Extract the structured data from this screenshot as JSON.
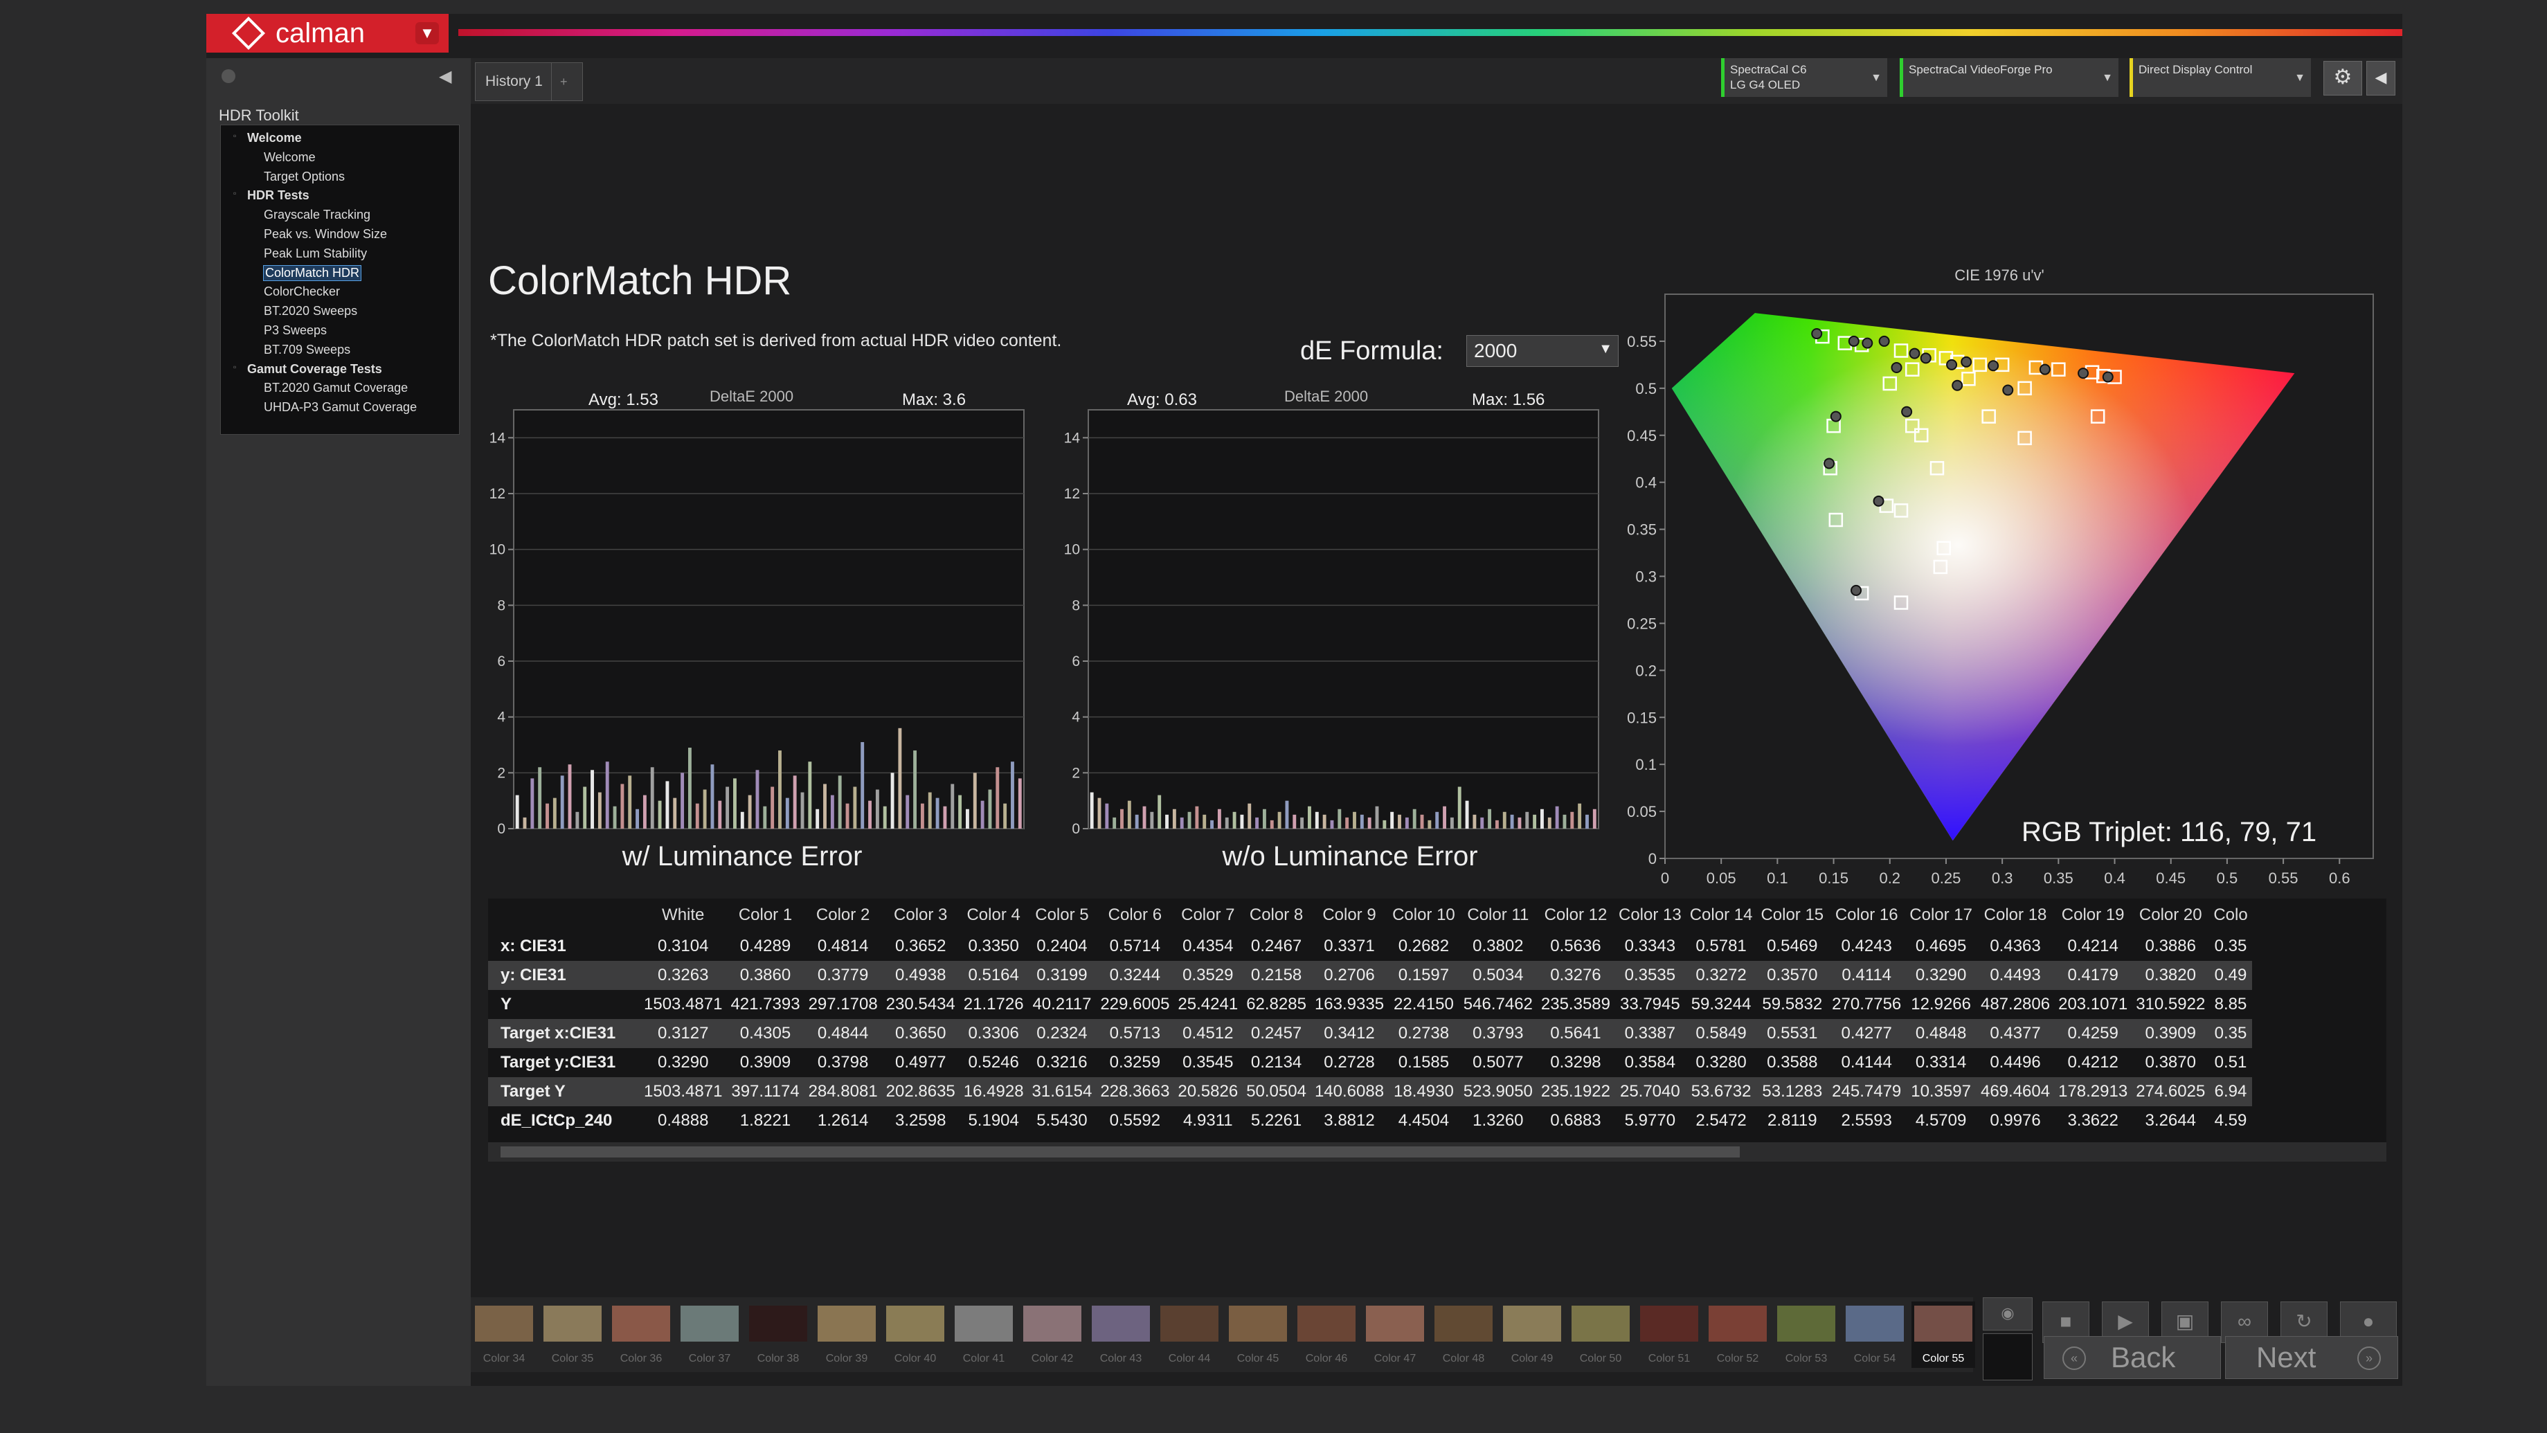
{
  "app": {
    "logo_text": "calman"
  },
  "sidebar": {
    "title": "HDR Toolkit",
    "items": [
      {
        "label": "Welcome",
        "level": 0
      },
      {
        "label": "Welcome",
        "level": 1
      },
      {
        "label": "Target Options",
        "level": 1
      },
      {
        "label": "HDR Tests",
        "level": 0
      },
      {
        "label": "Grayscale Tracking",
        "level": 1
      },
      {
        "label": "Peak vs. Window Size",
        "level": 1
      },
      {
        "label": "Peak Lum Stability",
        "level": 1
      },
      {
        "label": "ColorMatch HDR",
        "level": 1,
        "selected": true
      },
      {
        "label": "ColorChecker",
        "level": 1
      },
      {
        "label": "BT.2020 Sweeps",
        "level": 1
      },
      {
        "label": "P3 Sweeps",
        "level": 1
      },
      {
        "label": "BT.709 Sweeps",
        "level": 1
      },
      {
        "label": "Gamut Coverage Tests",
        "level": 0
      },
      {
        "label": "BT.2020 Gamut Coverage",
        "level": 1
      },
      {
        "label": "UHDA-P3 Gamut Coverage",
        "level": 1
      }
    ]
  },
  "tabs": {
    "history": "History 1"
  },
  "devices": [
    {
      "line1": "SpectraCal C6",
      "line2": "LG G4 OLED"
    },
    {
      "line1": "SpectraCal VideoForge Pro",
      "line2": ""
    },
    {
      "line1": "Direct Display Control",
      "line2": ""
    }
  ],
  "page": {
    "title": "ColorMatch HDR",
    "note": "*The ColorMatch HDR patch set is derived from actual HDR video content.",
    "de_label": "dE Formula:",
    "de_value": "2000"
  },
  "charts": {
    "left": {
      "avg": "Avg: 1.53",
      "formula": "DeltaE 2000",
      "max": "Max: 3.6",
      "caption": "w/ Luminance Error"
    },
    "right": {
      "avg": "Avg: 0.63",
      "formula": "DeltaE 2000",
      "max": "Max: 1.56",
      "caption": "w/o Luminance Error"
    },
    "cie": {
      "title": "CIE 1976 u'v'",
      "rgb_triplet": "RGB Triplet: 116, 79, 71"
    }
  },
  "chart_data": [
    {
      "type": "bar",
      "title": "DeltaE 2000",
      "xlabel": "w/ Luminance Error",
      "ylim": [
        0,
        15
      ],
      "yticks": [
        0,
        2,
        4,
        6,
        8,
        10,
        12,
        14
      ],
      "values": [
        1.2,
        0.4,
        1.8,
        2.2,
        0.9,
        1.1,
        1.9,
        2.3,
        0.6,
        1.5,
        2.1,
        1.3,
        2.4,
        0.8,
        1.6,
        1.9,
        0.7,
        1.2,
        2.2,
        1.0,
        1.7,
        1.1,
        2.0,
        2.9,
        0.9,
        1.4,
        2.3,
        1.0,
        1.5,
        1.8,
        0.6,
        1.2,
        2.1,
        0.8,
        1.5,
        2.8,
        1.1,
        1.9,
        1.3,
        2.4,
        0.7,
        1.6,
        1.2,
        1.9,
        0.9,
        1.5,
        3.1,
        1.0,
        1.4,
        0.8,
        2.0,
        3.6,
        1.2,
        2.8,
        0.9,
        1.3,
        1.1,
        0.8,
        1.6,
        1.2,
        0.7,
        2.0,
        1.0,
        1.4,
        2.2,
        0.9,
        2.4,
        1.8
      ]
    },
    {
      "type": "bar",
      "title": "DeltaE 2000",
      "xlabel": "w/o Luminance Error",
      "ylim": [
        0,
        15
      ],
      "yticks": [
        0,
        2,
        4,
        6,
        8,
        10,
        12,
        14
      ],
      "values": [
        1.3,
        1.1,
        0.9,
        0.4,
        0.7,
        1.0,
        0.5,
        0.8,
        0.6,
        1.2,
        0.5,
        0.7,
        0.4,
        0.6,
        0.8,
        0.5,
        0.3,
        0.7,
        0.4,
        0.6,
        0.5,
        0.9,
        0.4,
        0.7,
        0.3,
        0.6,
        1.0,
        0.5,
        0.4,
        0.8,
        0.6,
        0.5,
        0.3,
        0.7,
        0.4,
        0.6,
        0.5,
        0.4,
        0.8,
        0.3,
        0.6,
        0.5,
        0.4,
        0.7,
        0.5,
        0.3,
        0.6,
        0.8,
        0.4,
        1.5,
        1.0,
        0.5,
        0.4,
        0.7,
        0.3,
        0.6,
        0.5,
        0.4,
        0.6,
        0.5,
        0.7,
        0.4,
        0.8,
        0.5,
        0.6,
        0.9,
        0.5,
        0.7
      ]
    },
    {
      "type": "scatter",
      "title": "CIE 1976 u'v'",
      "xlim": [
        0,
        0.63
      ],
      "ylim": [
        0,
        0.6
      ],
      "xticks": [
        0,
        0.05,
        0.1,
        0.15,
        0.2,
        0.25,
        0.3,
        0.35,
        0.4,
        0.45,
        0.5,
        0.55,
        0.6
      ],
      "yticks": [
        0,
        0.05,
        0.1,
        0.15,
        0.2,
        0.25,
        0.3,
        0.35,
        0.4,
        0.45,
        0.5,
        0.55
      ],
      "gamut": [
        [
          0.256,
          0.019
        ],
        [
          0.56,
          0.516
        ],
        [
          0.08,
          0.58
        ],
        [
          0.006,
          0.5
        ]
      ],
      "targets": [
        [
          0.14,
          0.555
        ],
        [
          0.16,
          0.548
        ],
        [
          0.175,
          0.546
        ],
        [
          0.21,
          0.54
        ],
        [
          0.235,
          0.535
        ],
        [
          0.25,
          0.532
        ],
        [
          0.26,
          0.528
        ],
        [
          0.28,
          0.525
        ],
        [
          0.3,
          0.525
        ],
        [
          0.33,
          0.522
        ],
        [
          0.35,
          0.52
        ],
        [
          0.38,
          0.517
        ],
        [
          0.39,
          0.513
        ],
        [
          0.4,
          0.512
        ],
        [
          0.22,
          0.52
        ],
        [
          0.27,
          0.51
        ],
        [
          0.32,
          0.5
        ],
        [
          0.2,
          0.505
        ],
        [
          0.22,
          0.46
        ],
        [
          0.15,
          0.46
        ],
        [
          0.288,
          0.47
        ],
        [
          0.228,
          0.45
        ],
        [
          0.32,
          0.447
        ],
        [
          0.385,
          0.47
        ],
        [
          0.242,
          0.415
        ],
        [
          0.147,
          0.415
        ],
        [
          0.152,
          0.36
        ],
        [
          0.197,
          0.375
        ],
        [
          0.21,
          0.37
        ],
        [
          0.248,
          0.33
        ],
        [
          0.245,
          0.31
        ],
        [
          0.175,
          0.282
        ],
        [
          0.21,
          0.272
        ]
      ],
      "measured": [
        [
          0.135,
          0.558
        ],
        [
          0.168,
          0.55
        ],
        [
          0.18,
          0.548
        ],
        [
          0.195,
          0.55
        ],
        [
          0.222,
          0.537
        ],
        [
          0.232,
          0.532
        ],
        [
          0.255,
          0.525
        ],
        [
          0.268,
          0.528
        ],
        [
          0.292,
          0.524
        ],
        [
          0.338,
          0.52
        ],
        [
          0.372,
          0.516
        ],
        [
          0.394,
          0.512
        ],
        [
          0.206,
          0.522
        ],
        [
          0.26,
          0.503
        ],
        [
          0.305,
          0.498
        ],
        [
          0.215,
          0.475
        ],
        [
          0.152,
          0.47
        ],
        [
          0.146,
          0.42
        ],
        [
          0.19,
          0.38
        ],
        [
          0.17,
          0.285
        ]
      ]
    }
  ],
  "table": {
    "headers": [
      "",
      "White",
      "Color 1",
      "Color 2",
      "Color 3",
      "Color 4",
      "Color 5",
      "Color 6",
      "Color 7",
      "Color 8",
      "Color 9",
      "Color 10",
      "Color 11",
      "Color 12",
      "Color 13",
      "Color 14",
      "Color 15",
      "Color 16",
      "Color 17",
      "Color 18",
      "Color 19",
      "Color 20",
      "Colo"
    ],
    "rows": [
      [
        "x: CIE31",
        "0.3104",
        "0.4289",
        "0.4814",
        "0.3652",
        "0.3350",
        "0.2404",
        "0.5714",
        "0.4354",
        "0.2467",
        "0.3371",
        "0.2682",
        "0.3802",
        "0.5636",
        "0.3343",
        "0.5781",
        "0.5469",
        "0.4243",
        "0.4695",
        "0.4363",
        "0.4214",
        "0.3886",
        "0.35"
      ],
      [
        "y: CIE31",
        "0.3263",
        "0.3860",
        "0.3779",
        "0.4938",
        "0.5164",
        "0.3199",
        "0.3244",
        "0.3529",
        "0.2158",
        "0.2706",
        "0.1597",
        "0.5034",
        "0.3276",
        "0.3535",
        "0.3272",
        "0.3570",
        "0.4114",
        "0.3290",
        "0.4493",
        "0.4179",
        "0.3820",
        "0.49"
      ],
      [
        "Y",
        "1503.4871",
        "421.7393",
        "297.1708",
        "230.5434",
        "21.1726",
        "40.2117",
        "229.6005",
        "25.4241",
        "62.8285",
        "163.9335",
        "22.4150",
        "546.7462",
        "235.3589",
        "33.7945",
        "59.3244",
        "59.5832",
        "270.7756",
        "12.9266",
        "487.2806",
        "203.1071",
        "310.5922",
        "8.85"
      ],
      [
        "Target x:CIE31",
        "0.3127",
        "0.4305",
        "0.4844",
        "0.3650",
        "0.3306",
        "0.2324",
        "0.5713",
        "0.4512",
        "0.2457",
        "0.3412",
        "0.2738",
        "0.3793",
        "0.5641",
        "0.3387",
        "0.5849",
        "0.5531",
        "0.4277",
        "0.4848",
        "0.4377",
        "0.4259",
        "0.3909",
        "0.35"
      ],
      [
        "Target y:CIE31",
        "0.3290",
        "0.3909",
        "0.3798",
        "0.4977",
        "0.5246",
        "0.3216",
        "0.3259",
        "0.3545",
        "0.2134",
        "0.2728",
        "0.1585",
        "0.5077",
        "0.3298",
        "0.3584",
        "0.3280",
        "0.3588",
        "0.4144",
        "0.3314",
        "0.4496",
        "0.4212",
        "0.3870",
        "0.51"
      ],
      [
        "Target Y",
        "1503.4871",
        "397.1174",
        "284.8081",
        "202.8635",
        "16.4928",
        "31.6154",
        "228.3663",
        "20.5826",
        "50.0504",
        "140.6088",
        "18.4930",
        "523.9050",
        "235.1922",
        "25.7040",
        "53.6732",
        "53.1283",
        "245.7479",
        "10.3597",
        "469.4604",
        "178.2913",
        "274.6025",
        "6.94"
      ],
      [
        "dE_ICtCp_240",
        "0.4888",
        "1.8221",
        "1.2614",
        "3.2598",
        "5.1904",
        "5.5430",
        "0.5592",
        "4.9311",
        "5.2261",
        "3.8812",
        "4.4504",
        "1.3260",
        "0.6883",
        "5.9770",
        "2.5472",
        "2.8119",
        "2.5593",
        "4.5709",
        "0.9976",
        "3.3622",
        "3.2644",
        "4.59"
      ]
    ]
  },
  "swatches": [
    {
      "label": "Color 34",
      "color": "#7a6247"
    },
    {
      "label": "Color 35",
      "color": "#8a7a5a"
    },
    {
      "label": "Color 36",
      "color": "#8a5848"
    },
    {
      "label": "Color 37",
      "color": "#6b7a78"
    },
    {
      "label": "Color 38",
      "color": "#2d1a1a"
    },
    {
      "label": "Color 39",
      "color": "#8a7552"
    },
    {
      "label": "Color 40",
      "color": "#8a7c55"
    },
    {
      "label": "Color 41",
      "color": "#7c7c7c"
    },
    {
      "label": "Color 42",
      "color": "#8a7276"
    },
    {
      "label": "Color 43",
      "color": "#6d6380"
    },
    {
      "label": "Color 44",
      "color": "#5a4030"
    },
    {
      "label": "Color 45",
      "color": "#7a5e42"
    },
    {
      "label": "Color 46",
      "color": "#6a4535"
    },
    {
      "label": "Color 47",
      "color": "#8a6050"
    },
    {
      "label": "Color 48",
      "color": "#614a33"
    },
    {
      "label": "Color 49",
      "color": "#8a7c58"
    },
    {
      "label": "Color 50",
      "color": "#7a7448"
    },
    {
      "label": "Color 51",
      "color": "#5a2a25"
    },
    {
      "label": "Color 52",
      "color": "#7a4035"
    },
    {
      "label": "Color 53",
      "color": "#5e6a38"
    },
    {
      "label": "Color 54",
      "color": "#5a6a88"
    },
    {
      "label": "Color 55",
      "color": "#744f47",
      "active": true
    }
  ],
  "nav": {
    "back": "Back",
    "next": "Next"
  }
}
